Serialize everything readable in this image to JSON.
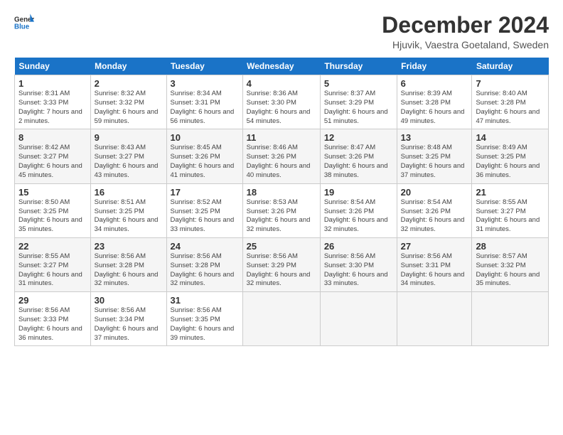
{
  "header": {
    "title": "December 2024",
    "subtitle": "Hjuvik, Vaestra Goetaland, Sweden"
  },
  "calendar": {
    "headers": [
      "Sunday",
      "Monday",
      "Tuesday",
      "Wednesday",
      "Thursday",
      "Friday",
      "Saturday"
    ],
    "weeks": [
      [
        null,
        {
          "day": "2",
          "sunrise": "Sunrise: 8:32 AM",
          "sunset": "Sunset: 3:32 PM",
          "daylight": "Daylight: 6 hours and 59 minutes."
        },
        {
          "day": "3",
          "sunrise": "Sunrise: 8:34 AM",
          "sunset": "Sunset: 3:31 PM",
          "daylight": "Daylight: 6 hours and 56 minutes."
        },
        {
          "day": "4",
          "sunrise": "Sunrise: 8:36 AM",
          "sunset": "Sunset: 3:30 PM",
          "daylight": "Daylight: 6 hours and 54 minutes."
        },
        {
          "day": "5",
          "sunrise": "Sunrise: 8:37 AM",
          "sunset": "Sunset: 3:29 PM",
          "daylight": "Daylight: 6 hours and 51 minutes."
        },
        {
          "day": "6",
          "sunrise": "Sunrise: 8:39 AM",
          "sunset": "Sunset: 3:28 PM",
          "daylight": "Daylight: 6 hours and 49 minutes."
        },
        {
          "day": "7",
          "sunrise": "Sunrise: 8:40 AM",
          "sunset": "Sunset: 3:28 PM",
          "daylight": "Daylight: 6 hours and 47 minutes."
        }
      ],
      [
        {
          "day": "1",
          "sunrise": "Sunrise: 8:31 AM",
          "sunset": "Sunset: 3:33 PM",
          "daylight": "Daylight: 7 hours and 2 minutes."
        },
        null,
        null,
        null,
        null,
        null,
        null
      ],
      [
        {
          "day": "8",
          "sunrise": "Sunrise: 8:42 AM",
          "sunset": "Sunset: 3:27 PM",
          "daylight": "Daylight: 6 hours and 45 minutes."
        },
        {
          "day": "9",
          "sunrise": "Sunrise: 8:43 AM",
          "sunset": "Sunset: 3:27 PM",
          "daylight": "Daylight: 6 hours and 43 minutes."
        },
        {
          "day": "10",
          "sunrise": "Sunrise: 8:45 AM",
          "sunset": "Sunset: 3:26 PM",
          "daylight": "Daylight: 6 hours and 41 minutes."
        },
        {
          "day": "11",
          "sunrise": "Sunrise: 8:46 AM",
          "sunset": "Sunset: 3:26 PM",
          "daylight": "Daylight: 6 hours and 40 minutes."
        },
        {
          "day": "12",
          "sunrise": "Sunrise: 8:47 AM",
          "sunset": "Sunset: 3:26 PM",
          "daylight": "Daylight: 6 hours and 38 minutes."
        },
        {
          "day": "13",
          "sunrise": "Sunrise: 8:48 AM",
          "sunset": "Sunset: 3:25 PM",
          "daylight": "Daylight: 6 hours and 37 minutes."
        },
        {
          "day": "14",
          "sunrise": "Sunrise: 8:49 AM",
          "sunset": "Sunset: 3:25 PM",
          "daylight": "Daylight: 6 hours and 36 minutes."
        }
      ],
      [
        {
          "day": "15",
          "sunrise": "Sunrise: 8:50 AM",
          "sunset": "Sunset: 3:25 PM",
          "daylight": "Daylight: 6 hours and 35 minutes."
        },
        {
          "day": "16",
          "sunrise": "Sunrise: 8:51 AM",
          "sunset": "Sunset: 3:25 PM",
          "daylight": "Daylight: 6 hours and 34 minutes."
        },
        {
          "day": "17",
          "sunrise": "Sunrise: 8:52 AM",
          "sunset": "Sunset: 3:25 PM",
          "daylight": "Daylight: 6 hours and 33 minutes."
        },
        {
          "day": "18",
          "sunrise": "Sunrise: 8:53 AM",
          "sunset": "Sunset: 3:26 PM",
          "daylight": "Daylight: 6 hours and 32 minutes."
        },
        {
          "day": "19",
          "sunrise": "Sunrise: 8:54 AM",
          "sunset": "Sunset: 3:26 PM",
          "daylight": "Daylight: 6 hours and 32 minutes."
        },
        {
          "day": "20",
          "sunrise": "Sunrise: 8:54 AM",
          "sunset": "Sunset: 3:26 PM",
          "daylight": "Daylight: 6 hours and 32 minutes."
        },
        {
          "day": "21",
          "sunrise": "Sunrise: 8:55 AM",
          "sunset": "Sunset: 3:27 PM",
          "daylight": "Daylight: 6 hours and 31 minutes."
        }
      ],
      [
        {
          "day": "22",
          "sunrise": "Sunrise: 8:55 AM",
          "sunset": "Sunset: 3:27 PM",
          "daylight": "Daylight: 6 hours and 31 minutes."
        },
        {
          "day": "23",
          "sunrise": "Sunrise: 8:56 AM",
          "sunset": "Sunset: 3:28 PM",
          "daylight": "Daylight: 6 hours and 32 minutes."
        },
        {
          "day": "24",
          "sunrise": "Sunrise: 8:56 AM",
          "sunset": "Sunset: 3:28 PM",
          "daylight": "Daylight: 6 hours and 32 minutes."
        },
        {
          "day": "25",
          "sunrise": "Sunrise: 8:56 AM",
          "sunset": "Sunset: 3:29 PM",
          "daylight": "Daylight: 6 hours and 32 minutes."
        },
        {
          "day": "26",
          "sunrise": "Sunrise: 8:56 AM",
          "sunset": "Sunset: 3:30 PM",
          "daylight": "Daylight: 6 hours and 33 minutes."
        },
        {
          "day": "27",
          "sunrise": "Sunrise: 8:56 AM",
          "sunset": "Sunset: 3:31 PM",
          "daylight": "Daylight: 6 hours and 34 minutes."
        },
        {
          "day": "28",
          "sunrise": "Sunrise: 8:57 AM",
          "sunset": "Sunset: 3:32 PM",
          "daylight": "Daylight: 6 hours and 35 minutes."
        }
      ],
      [
        {
          "day": "29",
          "sunrise": "Sunrise: 8:56 AM",
          "sunset": "Sunset: 3:33 PM",
          "daylight": "Daylight: 6 hours and 36 minutes."
        },
        {
          "day": "30",
          "sunrise": "Sunrise: 8:56 AM",
          "sunset": "Sunset: 3:34 PM",
          "daylight": "Daylight: 6 hours and 37 minutes."
        },
        {
          "day": "31",
          "sunrise": "Sunrise: 8:56 AM",
          "sunset": "Sunset: 3:35 PM",
          "daylight": "Daylight: 6 hours and 39 minutes."
        },
        null,
        null,
        null,
        null
      ]
    ]
  }
}
